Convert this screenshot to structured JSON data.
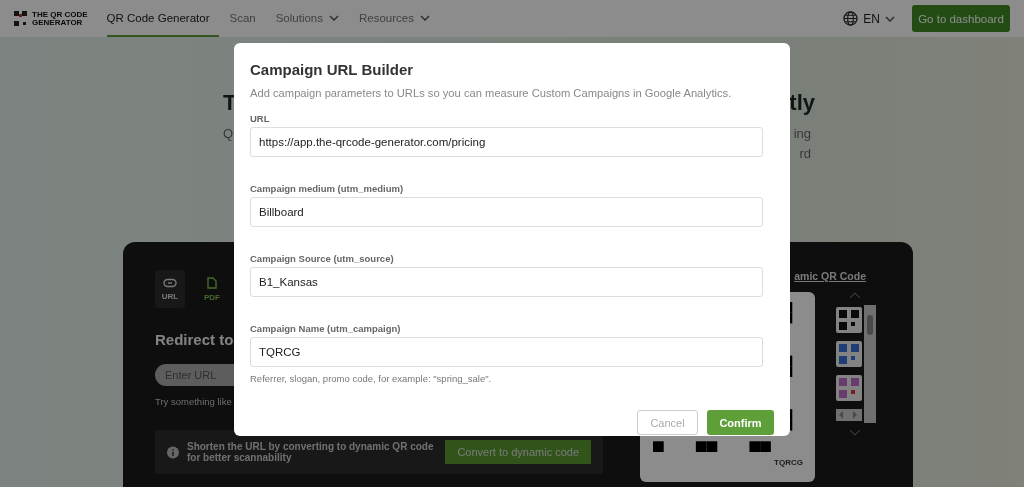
{
  "header": {
    "logo": [
      "THE QR CODE",
      "GENERATOR"
    ],
    "nav": [
      {
        "label": "QR Code Generator",
        "selected": true,
        "dropdown": false
      },
      {
        "label": "Scan",
        "selected": false,
        "dropdown": false
      },
      {
        "label": "Solutions",
        "selected": false,
        "dropdown": true
      },
      {
        "label": "Resources",
        "selected": false,
        "dropdown": true
      }
    ],
    "language": "EN",
    "dashboard_button": "Go to dashboard"
  },
  "hero": {
    "heading": [
      "T",
      "tly"
    ],
    "subtitle": [
      "Q",
      "ing",
      "rd"
    ]
  },
  "generator": {
    "types": [
      {
        "label": "URL",
        "kind": "link",
        "selected": true
      },
      {
        "label": "PDF",
        "kind": "file",
        "selected": false
      }
    ],
    "heading": "Redirect to",
    "url_input": {
      "placeholder": "Enter URL"
    },
    "hint": "Try something like",
    "notice": "Shorten the URL by converting to dynamic QR code for better scannability",
    "convert_button": "Convert to dynamic code",
    "dynamic_link": "amic QR Code",
    "qr_caption": "TQRCG"
  },
  "dialog": {
    "title": "Campaign URL Builder",
    "description": "Add campaign parameters to URLs so you can measure Custom Campaigns in Google Analytics.",
    "fields": [
      {
        "label": "URL",
        "value": "https://app.the-qrcode-generator.com/pricing"
      },
      {
        "label": "Campaign medium (utm_medium)",
        "value": "Billboard"
      },
      {
        "label": "Campaign Source (utm_source)",
        "value": "B1_Kansas"
      },
      {
        "label": "Campaign Name (utm_campaign)",
        "value": "TQRCG",
        "help": "Referrer, slogan, promo code, for example: \"spring_sale\"."
      }
    ],
    "cancel_button": "Cancel",
    "confirm_button": "Confirm"
  }
}
